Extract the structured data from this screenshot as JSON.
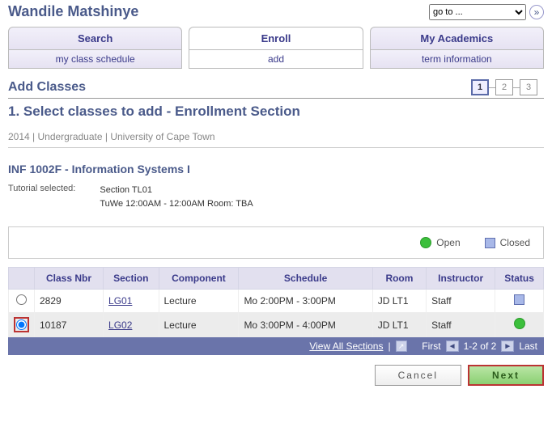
{
  "user_name": "Wandile Matshinye",
  "goto": {
    "placeholder": "go to ..."
  },
  "tabs": {
    "search": "Search",
    "enroll": "Enroll",
    "academics": "My Academics"
  },
  "subtabs": {
    "schedule": "my class schedule",
    "add": "add",
    "term": "term information"
  },
  "page_title": "Add Classes",
  "section_heading": "1.  Select classes to add - Enrollment Section",
  "steps": {
    "s1": "1",
    "s2": "2",
    "s3": "3"
  },
  "term_line": "2014 | Undergraduate | University of Cape Town",
  "course_title": "INF 1002F - Information Systems I",
  "tutorial": {
    "label": "Tutorial selected:",
    "section": "Section TL01",
    "detail": "TuWe 12:00AM - 12:00AM   Room:  TBA"
  },
  "legend": {
    "open": "Open",
    "closed": "Closed"
  },
  "table": {
    "headers": {
      "select": "",
      "class_nbr": "Class Nbr",
      "section": "Section",
      "component": "Component",
      "schedule": "Schedule",
      "room": "Room",
      "instructor": "Instructor",
      "status": "Status"
    },
    "rows": [
      {
        "class_nbr": "2829",
        "section": "LG01",
        "component": "Lecture",
        "schedule": "Mo 2:00PM - 3:00PM",
        "room": "JD LT1",
        "instructor": "Staff",
        "status": "closed",
        "selected": false
      },
      {
        "class_nbr": "10187",
        "section": "LG02",
        "component": "Lecture",
        "schedule": "Mo 3:00PM - 4:00PM",
        "room": "JD LT1",
        "instructor": "Staff",
        "status": "open",
        "selected": true
      }
    ]
  },
  "pager": {
    "view_all": "View All Sections",
    "first": "First",
    "range": "1-2 of 2",
    "last": "Last"
  },
  "buttons": {
    "cancel": "Cancel",
    "next": "Next"
  }
}
